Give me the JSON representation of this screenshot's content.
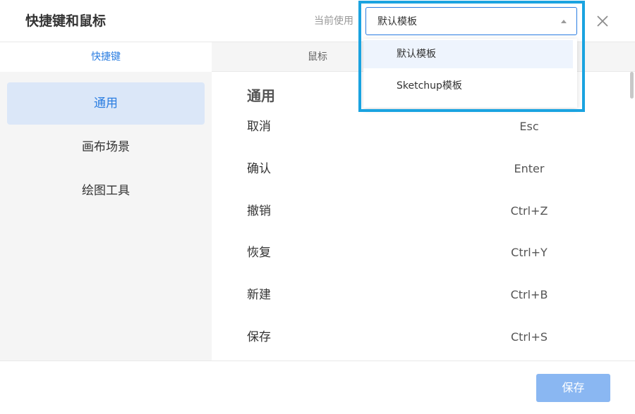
{
  "header": {
    "title": "快捷键和鼠标",
    "current_label": "当前使用",
    "select_value": "默认模板",
    "close_icon": "close-icon"
  },
  "tabs": [
    {
      "label": "快捷键",
      "active": true
    },
    {
      "label": "鼠标",
      "active": false
    }
  ],
  "sidebar": {
    "items": [
      {
        "label": "通用",
        "active": true
      },
      {
        "label": "画布场景",
        "active": false
      },
      {
        "label": "绘图工具",
        "active": false
      }
    ]
  },
  "content": {
    "section_title": "通用",
    "shortcuts": [
      {
        "name": "取消",
        "key": "Esc"
      },
      {
        "name": "确认",
        "key": "Enter"
      },
      {
        "name": "撤销",
        "key": "Ctrl+Z"
      },
      {
        "name": "恢复",
        "key": "Ctrl+Y"
      },
      {
        "name": "新建",
        "key": "Ctrl+B"
      },
      {
        "name": "保存",
        "key": "Ctrl+S"
      }
    ]
  },
  "dropdown": {
    "options": [
      {
        "label": "默认模板",
        "selected": true
      },
      {
        "label": "Sketchup模板",
        "selected": false
      }
    ]
  },
  "footer": {
    "save_label": "保存"
  },
  "colors": {
    "accent": "#2a7de1",
    "highlight_frame": "#1aa3e0",
    "save_button": "#8ab7f2"
  }
}
